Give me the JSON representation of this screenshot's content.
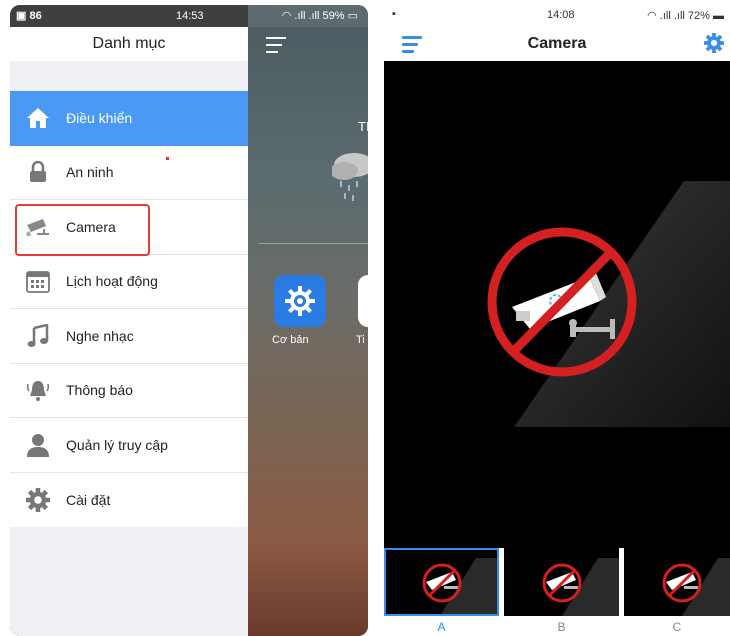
{
  "left_phone": {
    "status": {
      "left": "86",
      "time": "14:53",
      "battery": "59%"
    },
    "drawer": {
      "title": "Danh mục",
      "items": [
        {
          "label": "Điều khiển",
          "icon": "home-icon",
          "active": true
        },
        {
          "label": "An ninh",
          "icon": "lock-icon"
        },
        {
          "label": "Camera",
          "icon": "camera-icon",
          "highlighted": true
        },
        {
          "label": "Lịch hoạt động",
          "icon": "calendar-icon"
        },
        {
          "label": "Nghe nhạc",
          "icon": "music-icon"
        },
        {
          "label": "Thông báo",
          "icon": "bell-icon"
        },
        {
          "label": "Quản lý truy cập",
          "icon": "user-icon"
        },
        {
          "label": "Cài đặt",
          "icon": "gear-icon"
        }
      ],
      "active_color": "#4a9af5",
      "highlight_color": "#e23b3b"
    },
    "underlay": {
      "weather_label": "TI",
      "apps": [
        {
          "label": "Cơ bản",
          "icon": "gear-icon"
        },
        {
          "label": "Ti"
        }
      ]
    }
  },
  "right_phone": {
    "status": {
      "time": "14:08",
      "battery": "72%"
    },
    "title": "Camera",
    "accent_color": "#3a8ee6",
    "no_camera_icon": "no-camera-icon",
    "thumbnails": [
      {
        "label": "A",
        "selected": true
      },
      {
        "label": "B"
      },
      {
        "label": "C"
      }
    ]
  }
}
